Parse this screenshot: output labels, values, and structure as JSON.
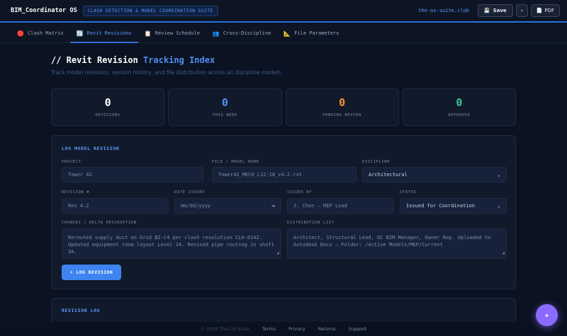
{
  "app": {
    "brand": "BIM_Coordinator OS",
    "suite": "CLASH DETECTION & MODEL COORDINATION SUITE",
    "domain": "the-os-suite.club",
    "save_label": "Save",
    "more_label": "▾",
    "pdf_label": "PDF"
  },
  "tabs": [
    {
      "icon": "🔴",
      "label": "Clash Matrix",
      "active": false
    },
    {
      "icon": "🔄",
      "label": "Revit Revisions",
      "active": true
    },
    {
      "icon": "📋",
      "label": "Review Schedule",
      "active": false
    },
    {
      "icon": "👥",
      "label": "Cross-Discipline",
      "active": false
    },
    {
      "icon": "📐",
      "label": "File Parameters",
      "active": false
    }
  ],
  "page": {
    "title_prefix": "// Revit Revision ",
    "title_accent": "Tracking Index",
    "subtitle": "Track model revisions, version history, and file distribution across all discipline models."
  },
  "stats": [
    {
      "value": "0",
      "label": "REVISIONS",
      "color": "#ffffff"
    },
    {
      "value": "0",
      "label": "THIS WEEK",
      "color": "#4f8df5"
    },
    {
      "value": "0",
      "label": "PENDING REVIEW",
      "color": "#f5922f"
    },
    {
      "value": "0",
      "label": "APPROVED",
      "color": "#2fcb8f"
    }
  ],
  "form": {
    "title": "LOG MODEL REVISION",
    "project_label": "PROJECT",
    "project_placeholder": "Tower 42",
    "file_label": "FILE / MODEL NAME",
    "file_placeholder": "Tower42_MECH_L12-18_v4.2.rvt",
    "discipline_label": "DISCIPLINE",
    "discipline_value": "Architectural",
    "revision_label": "REVISION #",
    "revision_placeholder": "Rev 4.2",
    "date_label": "DATE ISSUED",
    "date_placeholder": "mm/dd/yyyy",
    "issued_by_label": "ISSUED BY",
    "issued_by_placeholder": "J. Chen — MEP Lead",
    "status_label": "STATUS",
    "status_value": "Issued for Coordination",
    "changes_label": "CHANGES / DELTA DESCRIPTION",
    "changes_placeholder": "Rerouted supply duct on Grid B2-C4 per clash resolution CLH-0142. Updated equipment room layout Level 14. Revised pipe routing in shaft 3A.",
    "distribution_label": "DISTRIBUTION LIST",
    "distribution_placeholder": "Architect, Structural Lead, GC BIM Manager, Owner Rep. Uploaded to Autodesk Docs — Folder: /Active Models/MEP/Current",
    "submit_label": "+ LOG REVISION"
  },
  "log": {
    "title": "REVISION LOG"
  },
  "footer": {
    "copyright": "© 2026 The OS Suite",
    "links": [
      "Terms",
      "Privacy",
      "Returns",
      "Support"
    ]
  },
  "fab_icon": "✦"
}
